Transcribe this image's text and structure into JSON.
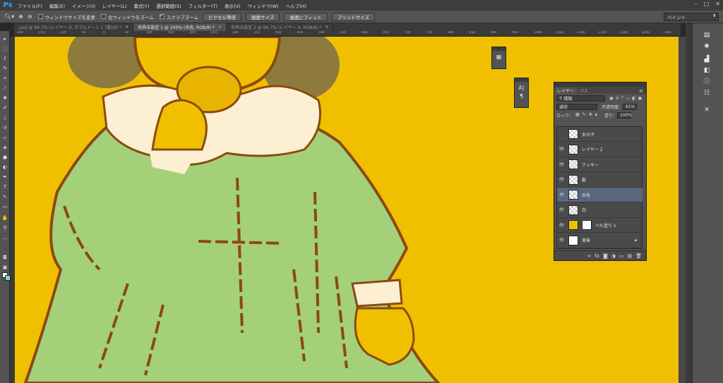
{
  "app": {
    "logo": "Ps"
  },
  "menu": [
    "ファイル(F)",
    "編集(E)",
    "イメージ(I)",
    "レイヤー(L)",
    "書式(Y)",
    "選択範囲(S)",
    "フィルター(T)",
    "表示(V)",
    "ウィンドウ(W)",
    "ヘルプ(H)"
  ],
  "window_controls": {
    "minimize": "–",
    "maximize": "□",
    "close": "✕"
  },
  "options_bar": {
    "tool_icon": "zoom-icon",
    "checks": [
      {
        "label": "ウィンドウサイズを変更",
        "checked": false
      },
      {
        "label": "全ウィンドウをズーム",
        "checked": false
      },
      {
        "label": "スクラブズーム",
        "checked": true
      }
    ],
    "buttons": [
      "ピクセル等倍",
      "画面サイズ",
      "画面にフィット",
      "プリントサイズ"
    ],
    "workspace": "ペイント"
  },
  "tabs": [
    {
      "label": ".psd @ 66.7% (レイヤー 0, ダブルトーン 1 (濃)/8) *",
      "active": false
    },
    {
      "label": "名称未設定 1 @ 200% (水色, RGB/8) *",
      "active": true
    },
    {
      "label": "名称未設定 2 @ 66.7% (レイヤー 4, RGB/8) *",
      "active": false
    }
  ],
  "ruler_ticks": [
    "200",
    "150",
    "100",
    "50",
    "0",
    "50",
    "100",
    "150",
    "200",
    "250",
    "300",
    "350",
    "400",
    "450",
    "500",
    "550",
    "600",
    "650",
    "700",
    "750",
    "800",
    "850",
    "900",
    "950",
    "1000",
    "1050",
    "1100",
    "1150",
    "1200",
    "1250",
    "1300"
  ],
  "layers_panel": {
    "tabs": [
      "レイヤー",
      "パス"
    ],
    "filter_label": "種類",
    "blend_mode": "通常",
    "opacity_label": "不透明度：",
    "opacity_value": "61%",
    "lock_label": "ロック：",
    "fill_label": "塗り：",
    "fill_value": "100%",
    "layers": [
      {
        "name": "女の子",
        "visible": false,
        "thumb": "checker",
        "selected": false
      },
      {
        "name": "レイヤー 2",
        "visible": true,
        "thumb": "checker",
        "selected": false
      },
      {
        "name": "クッキー",
        "visible": true,
        "thumb": "checker",
        "selected": false
      },
      {
        "name": "髪",
        "visible": true,
        "thumb": "checker",
        "selected": false
      },
      {
        "name": "水色",
        "visible": true,
        "thumb": "checker",
        "selected": true
      },
      {
        "name": "白",
        "visible": true,
        "thumb": "checker",
        "selected": false
      },
      {
        "name": "べた塗り 1",
        "visible": true,
        "thumb": "yellow",
        "selected": false
      },
      {
        "name": "背景",
        "visible": true,
        "thumb": "white",
        "selected": false,
        "locked": true
      }
    ]
  },
  "colors": {
    "canvas_bg": "#f0c000",
    "dress": "#a4d07a",
    "collar": "#fcefd2",
    "hair": "#8f7a3e",
    "outline": "#8a4a12",
    "foreground": "#ffffff",
    "background": "#8bd2d6"
  }
}
